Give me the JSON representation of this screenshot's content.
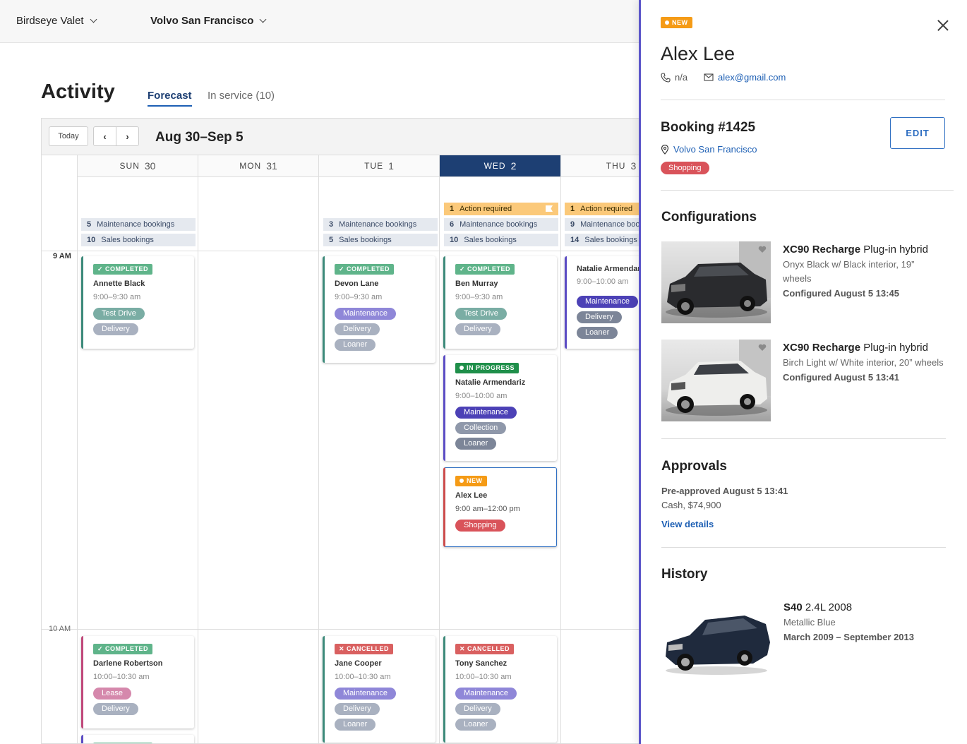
{
  "topbar": {
    "org": "Birdseye Valet",
    "dealer": "Volvo San Francisco"
  },
  "page": {
    "title": "Activity",
    "tab_forecast": "Forecast",
    "tab_inservice": "In service (10)"
  },
  "toolbar": {
    "today": "Today",
    "prev": "‹",
    "next": "›",
    "range": "Aug 30–Sep 5"
  },
  "days": [
    {
      "dow": "SUN",
      "num": "30"
    },
    {
      "dow": "MON",
      "num": "31"
    },
    {
      "dow": "TUE",
      "num": "1"
    },
    {
      "dow": "WED",
      "num": "2"
    },
    {
      "dow": "THU",
      "num": "3"
    }
  ],
  "times": {
    "nine": "9 AM",
    "ten": "10 AM"
  },
  "summaries": {
    "sun": {
      "m_n": "5",
      "m_l": "Maintenance bookings",
      "s_n": "10",
      "s_l": "Sales bookings"
    },
    "tue": {
      "m_n": "3",
      "m_l": "Maintenance bookings",
      "s_n": "5",
      "s_l": "Sales bookings"
    },
    "wed": {
      "a_n": "1",
      "a_l": "Action required",
      "m_n": "6",
      "m_l": "Maintenance bookings",
      "s_n": "10",
      "s_l": "Sales bookings"
    },
    "thu": {
      "a_n": "1",
      "a_l": "Action required",
      "m_n": "9",
      "m_l": "Maintenance bookings",
      "s_n": "14",
      "s_l": "Sales bookings"
    }
  },
  "statuses": {
    "completed": "✓ COMPLETED",
    "inprogress": "IN PROGRESS",
    "cancelled": "✕ CANCELLED",
    "new": "NEW"
  },
  "pills": {
    "testdrive": "Test Drive",
    "delivery": "Delivery",
    "maintenance": "Maintenance",
    "loaner": "Loaner",
    "collection": "Collection",
    "lease": "Lease",
    "shopping": "Shopping"
  },
  "cards": {
    "annette": {
      "name": "Annette Black",
      "time": "9:00–9:30 am"
    },
    "devon": {
      "name": "Devon Lane",
      "time": "9:00–9:30 am"
    },
    "ben": {
      "name": "Ben Murray",
      "time": "9:00–9:30 am"
    },
    "natalie_thu": {
      "name": "Natalie Armendariz",
      "time": "9:00–10:00 am"
    },
    "natalie_wed": {
      "name": "Natalie Armendariz",
      "time": "9:00–10:00 am"
    },
    "alex": {
      "name": "Alex Lee",
      "time": "9:00 am–12:00 pm"
    },
    "darlene": {
      "name": "Darlene Robertson",
      "time": "10:00–10:30 am"
    },
    "jane": {
      "name": "Jane Cooper",
      "time": "10:00–10:30 am"
    },
    "tony": {
      "name": "Tony Sanchez",
      "time": "10:00–10:30 am"
    }
  },
  "panel": {
    "badge": "NEW",
    "name": "Alex Lee",
    "phone": "n/a",
    "email": "alex@gmail.com",
    "booking": "Booking #1425",
    "edit": "EDIT",
    "location": "Volvo San Francisco",
    "tag": "Shopping",
    "config_title": "Configurations",
    "configs": [
      {
        "model": "XC90 Recharge",
        "variant": " Plug-in hybrid",
        "desc": "Onyx Black w/ Black interior, 19” wheels",
        "meta": "Configured August 5 13:45"
      },
      {
        "model": "XC90 Recharge",
        "variant": " Plug-in hybrid",
        "desc": "Birch Light w/ White interior, 20” wheels",
        "meta": "Configured August 5 13:41"
      }
    ],
    "approvals_title": "Approvals",
    "approval_line1": "Pre-approved August 5 13:41",
    "approval_line2": "Cash, $74,900",
    "view_details": "View details",
    "history_title": "History",
    "history": {
      "model": "S40",
      "variant": " 2.4L 2008",
      "desc": "Metallic Blue",
      "meta": "March 2009 – September 2013"
    }
  },
  "colors": {
    "accent": "#1d3f73",
    "link": "#1d5fb4",
    "panel_border": "#5b55c9",
    "new_badge": "#f59b16",
    "shopping": "#d9535a"
  }
}
